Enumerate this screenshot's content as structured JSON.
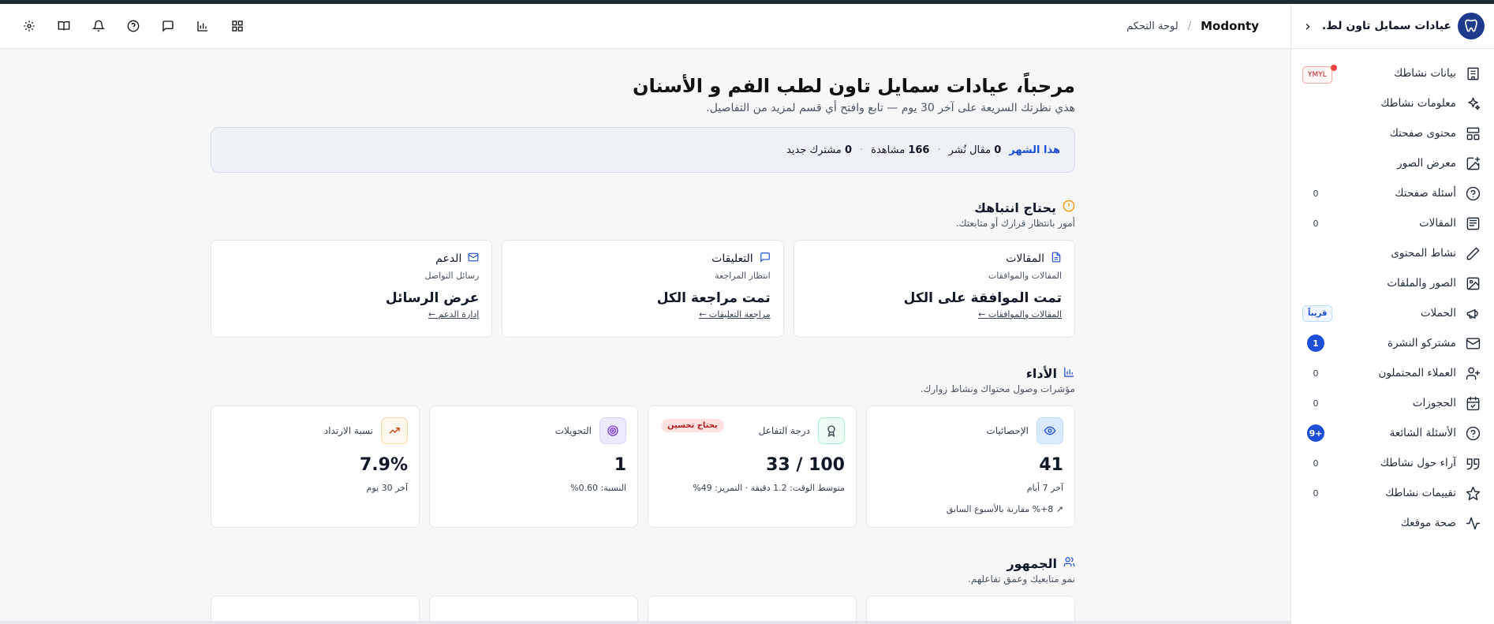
{
  "app": {
    "title": "عيادات سمايل تاون لط..."
  },
  "sidebar": {
    "items": [
      {
        "label": "بيانات نشاطك",
        "icon": "building-icon",
        "badge": "YMYL",
        "badge_type": "ymyl"
      },
      {
        "label": "معلومات نشاطك",
        "icon": "sparkles-icon",
        "badge": "",
        "badge_type": ""
      },
      {
        "label": "محتوى صفحتك",
        "icon": "layout-icon",
        "badge": "",
        "badge_type": ""
      },
      {
        "label": "معرض الصور",
        "icon": "image-plus-icon",
        "badge": "",
        "badge_type": ""
      },
      {
        "label": "أسئلة صفحتك",
        "icon": "question-circle-icon",
        "badge": "0",
        "badge_type": "count"
      },
      {
        "label": "المقالات",
        "icon": "newspaper-icon",
        "badge": "0",
        "badge_type": "count"
      },
      {
        "label": "نشاط المحتوى",
        "icon": "pen-icon",
        "badge": "",
        "badge_type": ""
      },
      {
        "label": "الصور والملفات",
        "icon": "images-icon",
        "badge": "",
        "badge_type": ""
      },
      {
        "label": "الحملات",
        "icon": "megaphone-icon",
        "badge": "قريباً",
        "badge_type": "soon"
      },
      {
        "label": "مشتركو النشرة",
        "icon": "mail-icon",
        "badge": "1",
        "badge_type": "blue"
      },
      {
        "label": "العملاء المحتملون",
        "icon": "user-plus-icon",
        "badge": "0",
        "badge_type": "count"
      },
      {
        "label": "الحجوزات",
        "icon": "calendar-icon",
        "badge": "0",
        "badge_type": "count"
      },
      {
        "label": "الأسئلة الشائعة",
        "icon": "help-circle-icon",
        "badge": "+9",
        "badge_type": "blue"
      },
      {
        "label": "آراء حول نشاطك",
        "icon": "quote-icon",
        "badge": "0",
        "badge_type": "count"
      },
      {
        "label": "تقييمات نشاطك",
        "icon": "star-icon",
        "badge": "0",
        "badge_type": "count"
      },
      {
        "label": "صحة موقعك",
        "icon": "activity-icon",
        "badge": "",
        "badge_type": ""
      }
    ]
  },
  "breadcrumb": {
    "root": "Modonty",
    "separator": "/",
    "current": "لوحة التحكم"
  },
  "toolbar": {
    "icons": [
      "settings-icon",
      "book-icon",
      "bell-icon",
      "help-icon",
      "message-icon",
      "bar-chart-icon",
      "grid-icon"
    ]
  },
  "greeting": {
    "title": "مرحباً، عيادات سمايل تاون لطب الفم و الأسنان",
    "subtitle": "هذي نظرتك السريعة على آخر 30 يوم — تابع وافتح أي قسم لمزيد من التفاصيل."
  },
  "month_summary": {
    "label": "هذا الشهر",
    "articles_num": "0",
    "articles_text": "مقال نُشر",
    "views_num": "166",
    "views_text": "مشاهدة",
    "subs_num": "0",
    "subs_text": "مشترك جديد",
    "dot": "·"
  },
  "attention": {
    "title": "يحتاج انتباهك",
    "subtitle": "أمور بانتظار قرارك أو متابعتك.",
    "cards": [
      {
        "title": "المقالات",
        "sub": "المقالات والموافقات",
        "value": "تمت الموافقة على الكل",
        "link": "المقالات والموافقات ←"
      },
      {
        "title": "التعليقات",
        "sub": "انتظار المراجعة",
        "value": "تمت مراجعة الكل",
        "link": "مراجعة التعليقات ←"
      },
      {
        "title": "الدعم",
        "sub": "رسائل التواصل",
        "value": "عرض الرسائل",
        "link": "إدارة الدعم ←"
      }
    ]
  },
  "performance": {
    "title": "الأداء",
    "subtitle": "مؤشرات وصول محتواك ونشاط زوارك.",
    "cards": [
      {
        "title": "الإحصائيات",
        "value": "41",
        "sub": "آخر 7 أيام",
        "trend": "↗ 8+% مقارنة بالأسبوع السابق",
        "tag": ""
      },
      {
        "title": "درجة التفاعل",
        "value": "33 / 100",
        "sub": "متوسط الوقت: 1.2 دقيقة · التمرير: 49%",
        "trend": "",
        "tag": "بحتاج تحسين"
      },
      {
        "title": "التحويلات",
        "value": "1",
        "sub": "النسبة: 0.60%",
        "trend": "",
        "tag": ""
      },
      {
        "title": "نسبة الارتداد",
        "value": "7.9%",
        "sub": "آخر 30 يوم",
        "trend": "",
        "tag": ""
      }
    ]
  },
  "audience": {
    "title": "الجمهور",
    "subtitle": "نمو متابعيك وعمق تفاعلهم."
  },
  "colors": {
    "accent": "#1d4ed8",
    "warning": "#f59e0b",
    "danger": "#b91c1c",
    "topstrip": "#1f2a30"
  }
}
